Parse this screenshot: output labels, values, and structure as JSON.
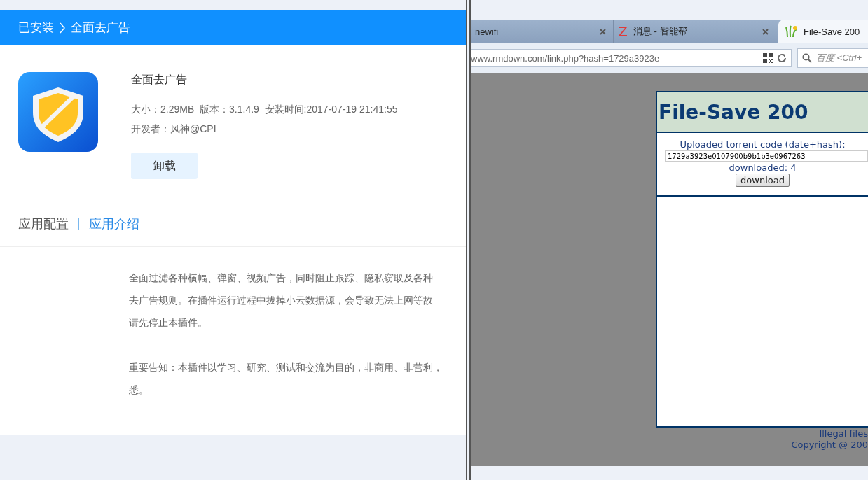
{
  "left_panel": {
    "breadcrumb": [
      "已安装",
      "全面去广告"
    ],
    "app": {
      "name": "全面去广告",
      "info": "大小：2.29MB  版本：3.1.4.9  安装时间:2017-07-19 21:41:55",
      "developer": "开发者：风神@CPI",
      "uninstall_button": "卸载"
    },
    "tabs": [
      {
        "label": "应用配置",
        "selected": false
      },
      {
        "label": "应用介绍",
        "selected": true
      }
    ],
    "description_paragraphs": [
      [
        "全面过滤各种横幅、弹窗、视频广告，同时阻止跟踪、隐私窃取及各种",
        "去广告规则。在插件运行过程中拔掉小云数据源，会导致无法上网等故",
        "请先停止本插件。"
      ],
      [
        "重要告知：本插件以学习、研究、测试和交流为目的，非商用、非营利，",
        "悉。"
      ]
    ]
  },
  "browser": {
    "tabs": [
      {
        "title": "newifi",
        "selected": false,
        "kind": "plain"
      },
      {
        "title": "消息 - 智能帮",
        "selected": false,
        "kind": "zlogo"
      },
      {
        "title": "File-Save 200",
        "selected": true,
        "kind": "sprout"
      }
    ],
    "address": "www.rmdown.com/link.php?hash=1729a3923e",
    "search_placeholder": "百度 <Ctrl+",
    "page": {
      "title": "File-Save 200",
      "label": "Uploaded torrent code (date+hash):",
      "hash": "1729a3923e0107900b9b1b3e0967263",
      "downloaded": "downloaded: 4",
      "download_button": "download",
      "footer": [
        "Illegal files",
        "Copyright @ 200"
      ]
    }
  }
}
